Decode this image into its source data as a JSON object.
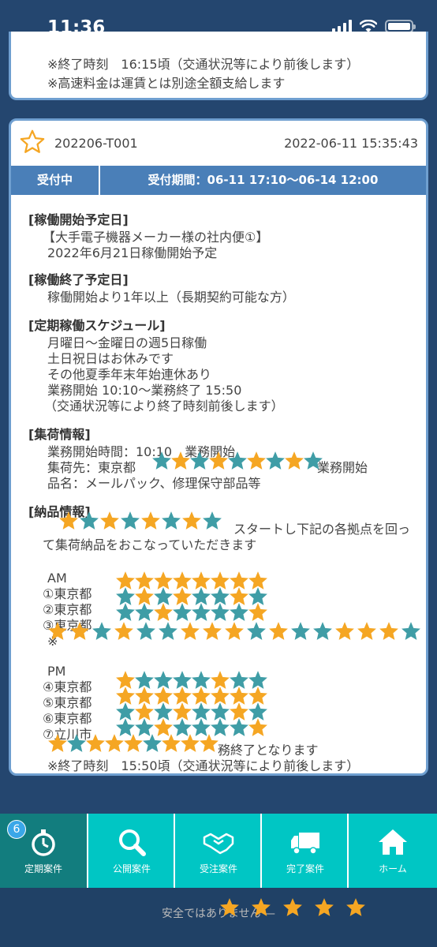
{
  "status_bar": {
    "time": "11:36"
  },
  "previous_card": {
    "lines": [
      "※終了時刻　16:15頃（交通状況等により前後します）",
      "※高速料金は運賃とは別途全額支給します"
    ]
  },
  "job": {
    "id": "202206-T001",
    "posted_at": "2022-06-11 15:35:43",
    "status": "受付中",
    "period": "受付期間：06-11 17:10〜06-14 12:00",
    "sections": {
      "start_title": "[稼働開始予定日]",
      "start_lines": [
        "【大手電子機器メーカー様の社内便①】",
        "2022年6月21日稼働開始予定"
      ],
      "end_title": "[稼働終了予定日]",
      "end_lines": [
        "稼働開始より1年以上（長期契約可能な方）"
      ],
      "schedule_title": "[定期稼働スケジュール]",
      "schedule_lines": [
        "月曜日〜金曜日の週5日稼働",
        "土日祝日はお休みです",
        "その他夏季年末年始連休あり",
        "業務開始 10:10〜業務終了 15:50",
        "（交通状況等により終了時刻前後します）"
      ],
      "pickup_title": "[集荷情報]",
      "pickup_lines": [
        "業務開始時間：10:10　業務開始",
        "集荷先：東京都",
        "業務開始",
        "品名：メールパック、修理保守部品等"
      ],
      "delivery_title": "[納品情報]",
      "delivery_lines": [
        "スタートし下記の各拠点を回っ",
        "て集荷納品をおこなっていただきます"
      ],
      "am_label": "AM",
      "am_items": [
        "①東京都",
        "②東京都",
        "③東京都",
        "※"
      ],
      "pm_label": "PM",
      "pm_items": [
        "④東京都",
        "⑤東京都",
        "⑥東京都",
        "⑦立川市"
      ],
      "finish_line": "務終了となります",
      "end_time_line": "※終了時刻　15:50頃（交通状況等により前後します）"
    }
  },
  "tabs": [
    {
      "label": "定期案件",
      "icon": "stopwatch-icon",
      "badge": "6"
    },
    {
      "label": "公開案件",
      "icon": "search-icon"
    },
    {
      "label": "受注案件",
      "icon": "handshake-icon"
    },
    {
      "label": "完了案件",
      "icon": "truck-icon"
    },
    {
      "label": "ホーム",
      "icon": "home-icon"
    }
  ],
  "browser": {
    "url_text": "安全ではありません —"
  },
  "colors": {
    "background": "#24466f",
    "card_border": "#6f9fd0",
    "status_row": "#4a7fb8",
    "tab_bar": "#00c6c4",
    "tab_active": "#127d7e",
    "star_orange": "#f5a623",
    "star_teal": "#3f9da6"
  }
}
